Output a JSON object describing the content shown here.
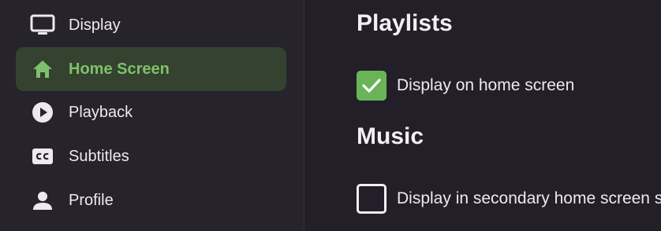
{
  "colors": {
    "accent": "#69b458",
    "accent_text": "#7ec16b",
    "sidebar_bg": "#26232d",
    "main_bg": "#221f29",
    "active_bg": "#34422f"
  },
  "sidebar": {
    "items": [
      {
        "label": "Display",
        "icon": "monitor-icon",
        "active": false
      },
      {
        "label": "Home Screen",
        "icon": "home-icon",
        "active": true
      },
      {
        "label": "Playback",
        "icon": "play-circle-icon",
        "active": false
      },
      {
        "label": "Subtitles",
        "icon": "closed-captions-icon",
        "active": false
      },
      {
        "label": "Profile",
        "icon": "person-icon",
        "active": false
      }
    ]
  },
  "main": {
    "sections": [
      {
        "title": "Playlists",
        "settings": [
          {
            "label": "Display on home screen",
            "checked": true
          }
        ]
      },
      {
        "title": "Music",
        "settings": [
          {
            "label": "Display in secondary home screen section",
            "checked": false
          }
        ]
      }
    ]
  }
}
